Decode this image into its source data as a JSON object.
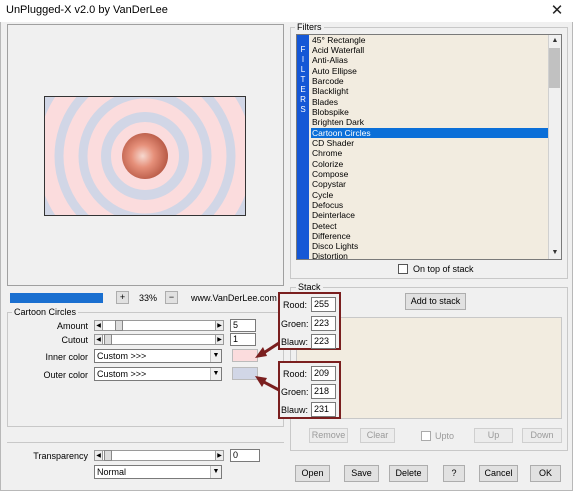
{
  "window": {
    "title": "UnPlugged-X v2.0 by VanDerLee",
    "close_glyph": "✕"
  },
  "preview": {
    "zoom_text": "33%",
    "plus_label": "+",
    "minus_label": "−",
    "site_text": "www.VanDerLee.com"
  },
  "filters": {
    "group_title": "Filters",
    "vertical_label": [
      "F",
      "I",
      "L",
      "T",
      "E",
      "R",
      "S"
    ],
    "items": [
      "45° Rectangle",
      "Acid Waterfall",
      "Anti-Alias",
      "Auto Ellipse",
      "Barcode",
      "Blacklight",
      "Blades",
      "Blobspike",
      "Brighten Dark",
      "Cartoon Circles",
      "CD Shader",
      "Chrome",
      "Colorize",
      "Compose",
      "Copystar",
      "Cycle",
      "Defocus",
      "Deinterlace",
      "Detect",
      "Difference",
      "Disco Lights",
      "Distortion"
    ],
    "selected_index": 9,
    "on_top_label": "On top of stack"
  },
  "cartoon": {
    "group_title": "Cartoon Circles",
    "amount_label": "Amount",
    "amount_value": "5",
    "cutout_label": "Cutout",
    "cutout_value": "1",
    "inner_label": "Inner color",
    "inner_value": "Custom >>>",
    "outer_label": "Outer color",
    "outer_value": "Custom >>>",
    "inner_swatch": "#fbdcdd",
    "outer_swatch": "#d1d6e6"
  },
  "transparency": {
    "label": "Transparency",
    "value": "0",
    "mode": "Normal"
  },
  "popup_inner": {
    "rood_label": "Rood:",
    "rood": "255",
    "groen_label": "Groen:",
    "groen": "223",
    "blauw_label": "Blauw:",
    "blauw": "223"
  },
  "popup_outer": {
    "rood_label": "Rood:",
    "rood": "209",
    "groen_label": "Groen:",
    "groen": "218",
    "blauw_label": "Blauw:",
    "blauw": "231"
  },
  "stack": {
    "group_title": "Stack",
    "add_label": "Add to stack",
    "remove_label": "Remove",
    "clear_label": "Clear",
    "upto_label": "Upto",
    "up_label": "Up",
    "down_label": "Down"
  },
  "footer": {
    "open_label": "Open",
    "save_label": "Save",
    "delete_label": "Delete",
    "help_label": "?",
    "cancel_label": "Cancel",
    "ok_label": "OK"
  },
  "colors": {
    "accent": "#0b6fd8",
    "filter_bar": "#1557d6",
    "popup_border": "#7a1f1f"
  }
}
